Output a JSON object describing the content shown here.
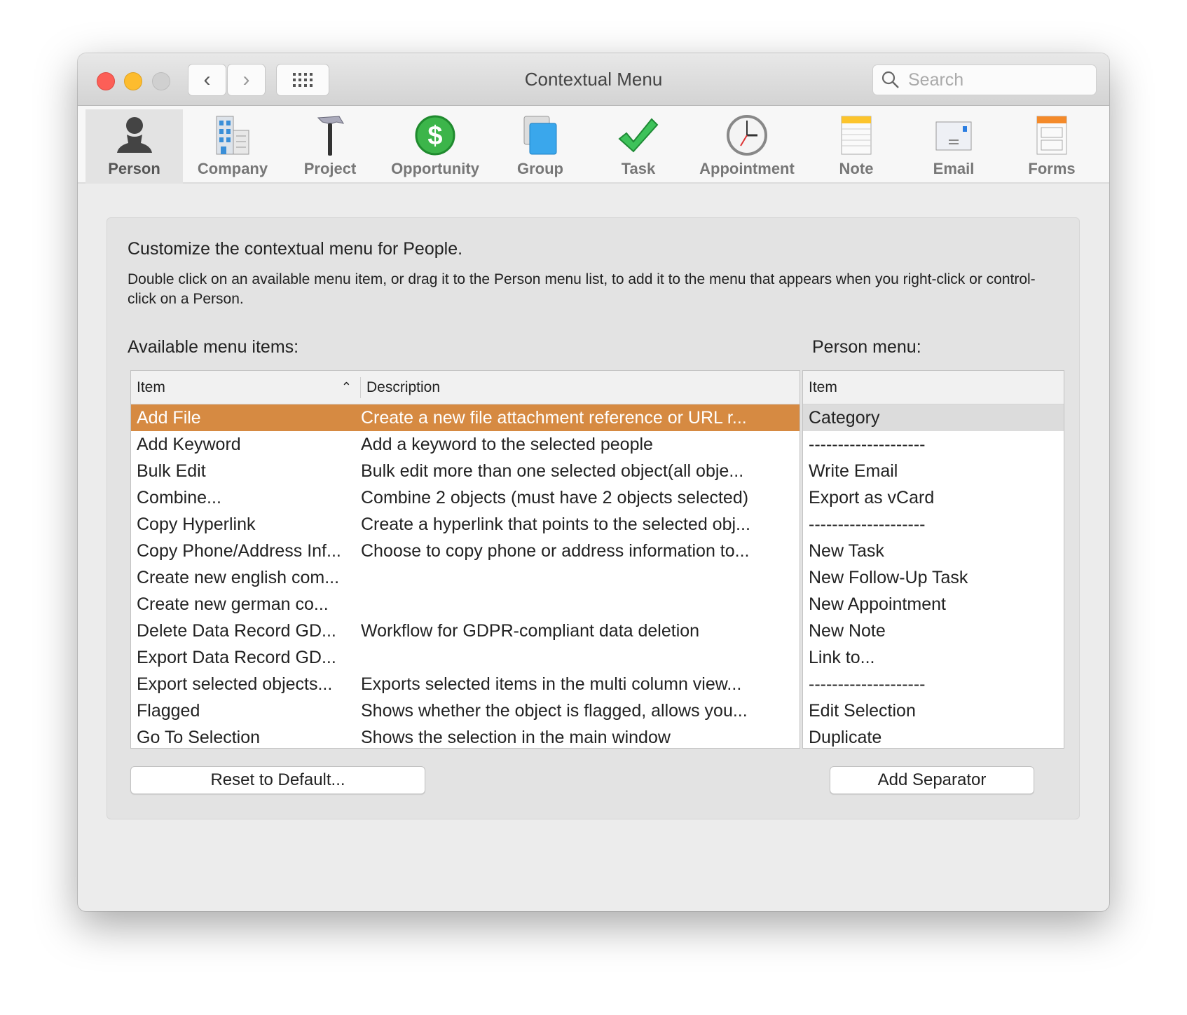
{
  "window": {
    "title": "Contextual Menu",
    "search_placeholder": "Search"
  },
  "toolbar": [
    {
      "label": "Person",
      "icon": "person-icon",
      "selected": true
    },
    {
      "label": "Company",
      "icon": "building-icon"
    },
    {
      "label": "Project",
      "icon": "hammer-icon"
    },
    {
      "label": "Opportunity",
      "icon": "dollar-icon"
    },
    {
      "label": "Group",
      "icon": "group-icon"
    },
    {
      "label": "Task",
      "icon": "checkmark-icon"
    },
    {
      "label": "Appointment",
      "icon": "clock-icon"
    },
    {
      "label": "Note",
      "icon": "note-icon"
    },
    {
      "label": "Email",
      "icon": "email-icon"
    },
    {
      "label": "Forms",
      "icon": "forms-icon"
    }
  ],
  "main": {
    "heading": "Customize the contextual menu for People.",
    "description": "Double click on an available menu item, or drag it to the Person menu list, to add it to the menu that appears when you right-click or control-click on a Person.",
    "available_label": "Available menu items:",
    "person_label": "Person menu:",
    "available_columns": [
      "Item",
      "Description"
    ],
    "available_rows": [
      [
        "Add File",
        "Create a new file attachment reference or URL r..."
      ],
      [
        "Add Keyword",
        "Add a keyword to the selected people"
      ],
      [
        "Bulk Edit",
        "Bulk edit more than one selected object(all obje..."
      ],
      [
        "Combine...",
        "Combine 2 objects (must have 2 objects selected)"
      ],
      [
        "Copy Hyperlink",
        "Create a hyperlink that points to the selected obj..."
      ],
      [
        "Copy Phone/Address Inf...",
        "Choose to copy phone or address information to..."
      ],
      [
        "Create new english com...",
        ""
      ],
      [
        "Create new german co...",
        ""
      ],
      [
        "Delete Data Record GD...",
        "Workflow for GDPR-compliant data deletion"
      ],
      [
        "Export Data Record GD...",
        ""
      ],
      [
        "Export selected objects...",
        "Exports selected items in the multi column view..."
      ],
      [
        "Flagged",
        "Shows whether the object is flagged, allows you..."
      ],
      [
        "Go To Selection",
        "Shows the selection in the main window"
      ]
    ],
    "person_column": "Item",
    "person_rows": [
      "Category",
      "--------------------",
      "Write Email",
      "Export as vCard",
      "--------------------",
      "New Task",
      "New Follow-Up Task",
      "New Appointment",
      "New Note",
      "Link to...",
      "--------------------",
      "Edit Selection",
      "Duplicate"
    ],
    "reset_button": "Reset to Default...",
    "add_separator_button": "Add Separator"
  },
  "colors": {
    "selection": "#d68a42"
  }
}
